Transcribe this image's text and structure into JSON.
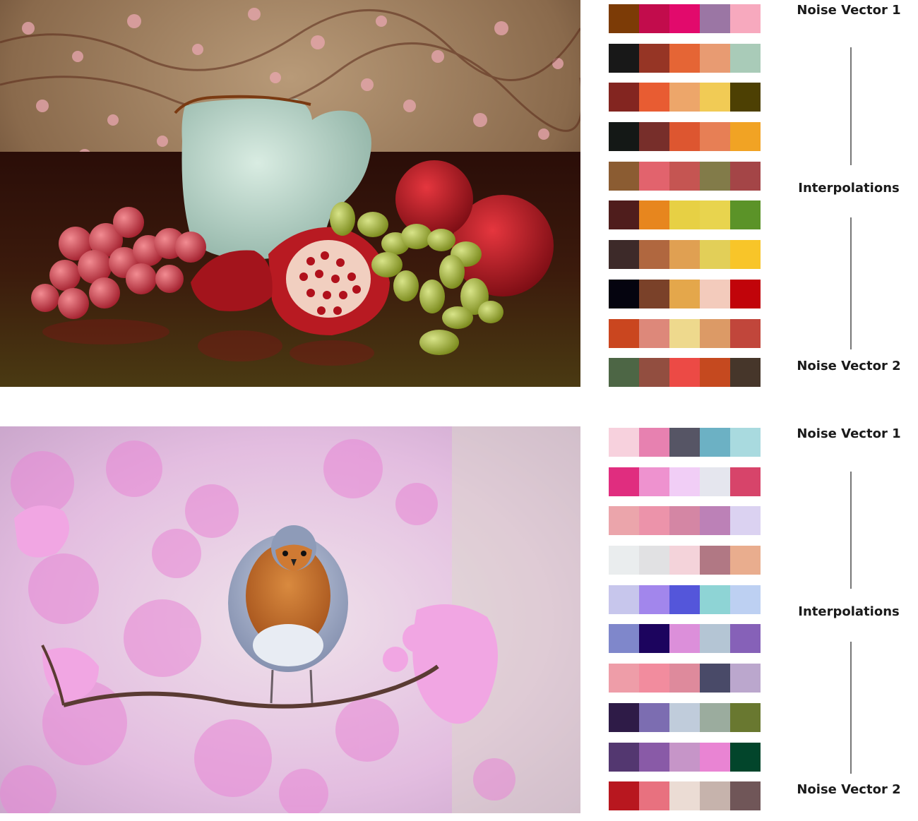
{
  "labels": {
    "noise_vector_1": "Noise Vector 1",
    "interpolations": "Interpolations",
    "noise_vector_2": "Noise Vector 2"
  },
  "panels": [
    {
      "image": "still-life: teal ceramic pitcher, pomegranates, red and green grapes, floral wallpaper",
      "palettes": [
        [
          "#7c3b06",
          "#c20c4c",
          "#e20a6c",
          "#9b76a4",
          "#f7a9be"
        ],
        [
          "#181818",
          "#963525",
          "#e56535",
          "#e89b72",
          "#a9cbb8"
        ],
        [
          "#832520",
          "#e85c32",
          "#eda66a",
          "#f1cb55",
          "#4d4003"
        ],
        [
          "#141816",
          "#772e2a",
          "#dd5630",
          "#e77f55",
          "#f1a324"
        ],
        [
          "#8b5c32",
          "#e2636d",
          "#c55552",
          "#827b49",
          "#a44547"
        ],
        [
          "#4f1d1c",
          "#e7861e",
          "#e7d044",
          "#e8d44e",
          "#5b9328"
        ],
        [
          "#3d2a29",
          "#b0673f",
          "#e0a052",
          "#e2cf58",
          "#f8c529"
        ],
        [
          "#05040f",
          "#7a4129",
          "#e4a74b",
          "#f3cbbc",
          "#c1040a"
        ],
        [
          "#ca461f",
          "#dd887a",
          "#eed98d",
          "#dc9a66",
          "#c1463b"
        ],
        [
          "#4d6645",
          "#924e40",
          "#ec4a45",
          "#c5491f",
          "#46362a"
        ]
      ]
    },
    {
      "image": "robin perched on a branch among pink blossoms",
      "palettes": [
        [
          "#f7d1dd",
          "#e781b0",
          "#565565",
          "#6cb1c4",
          "#a9dadf"
        ],
        [
          "#e02d7f",
          "#ee92cf",
          "#f1cef6",
          "#e5e6ee",
          "#d7446a"
        ],
        [
          "#eba5ab",
          "#ec93aa",
          "#d486a4",
          "#bc81b7",
          "#dbd2f1"
        ],
        [
          "#eaedee",
          "#e1e1e3",
          "#f4d3da",
          "#b17884",
          "#e9ad8e"
        ],
        [
          "#c7c6ec",
          "#a286ec",
          "#5456da",
          "#8ed4d5",
          "#bdd0f2"
        ],
        [
          "#7f87cb",
          "#1c045e",
          "#dc8fda",
          "#b4c5d4",
          "#8661b8"
        ],
        [
          "#ee9da8",
          "#f28c9e",
          "#de8a9c",
          "#494a68",
          "#bba7cd"
        ],
        [
          "#2e1b47",
          "#7c6db1",
          "#c0ccdb",
          "#9bac9e",
          "#697830"
        ],
        [
          "#533770",
          "#895aa7",
          "#c695c8",
          "#e984d3",
          "#02452b"
        ],
        [
          "#b8171f",
          "#e8717f",
          "#ebdcd4",
          "#c6b3ac",
          "#705658"
        ]
      ]
    }
  ]
}
